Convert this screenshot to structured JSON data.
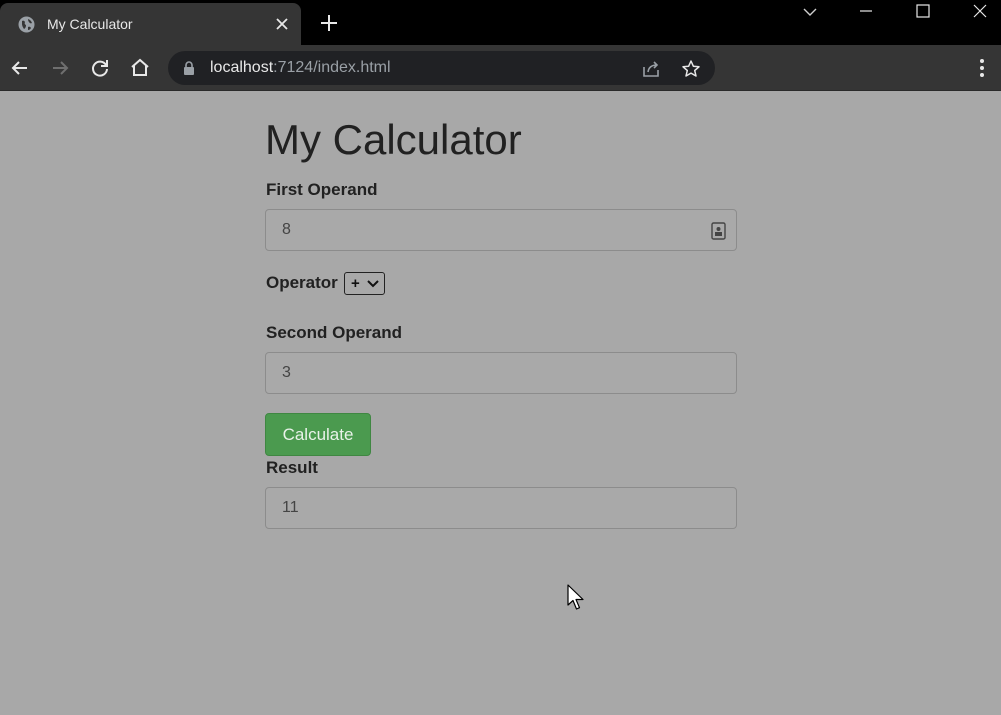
{
  "browser": {
    "tab_title": "My Calculator",
    "url_host": "localhost",
    "url_path": ":7124/index.html",
    "icons": {
      "favicon": "globe-icon",
      "tab_close": "close-icon",
      "new_tab": "plus-icon",
      "back": "arrow-left-icon",
      "forward": "arrow-right-icon",
      "reload": "reload-icon",
      "home": "home-icon",
      "lock": "lock-icon",
      "share": "share-icon",
      "bookmark": "star-icon",
      "menu": "kebab-menu-icon"
    }
  },
  "page": {
    "title": "My Calculator",
    "first_operand": {
      "label": "First Operand",
      "value": "8"
    },
    "operator": {
      "label": "Operator",
      "selected": "+"
    },
    "second_operand": {
      "label": "Second Operand",
      "value": "3"
    },
    "calculate_label": "Calculate",
    "result": {
      "label": "Result",
      "value": "11"
    }
  },
  "colors": {
    "page_background": "#a8a8a8",
    "button_background": "#4b9a4f",
    "browser_chrome": "#353535"
  }
}
